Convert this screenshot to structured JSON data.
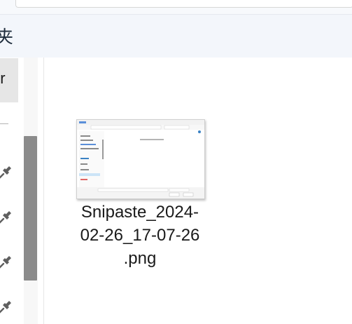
{
  "header": {
    "folder_title_partial": "夹"
  },
  "nav": {
    "selected_item_partial": "er"
  },
  "file": {
    "name": "Snipaste_2024-02-26_17-07-26.png",
    "name_line1": "Snipaste_2024-",
    "name_line2": "02-26_17-07-26",
    "name_line3": ".png"
  },
  "colors": {
    "header_bg": "#f3f6fb",
    "scrollbar_thumb": "#8b8b8b",
    "selected_nav_bg": "#e6e6e6"
  },
  "icons": {
    "pin": "pin-icon"
  }
}
